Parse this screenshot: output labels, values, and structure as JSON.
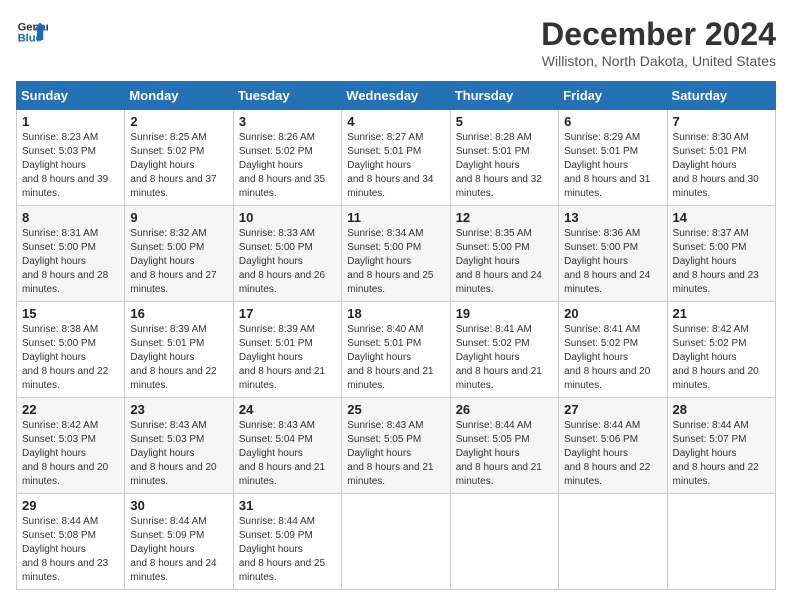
{
  "logo": {
    "line1": "General",
    "line2": "Blue"
  },
  "title": "December 2024",
  "subtitle": "Williston, North Dakota, United States",
  "days_of_week": [
    "Sunday",
    "Monday",
    "Tuesday",
    "Wednesday",
    "Thursday",
    "Friday",
    "Saturday"
  ],
  "weeks": [
    [
      {
        "day": "1",
        "sunrise": "8:23 AM",
        "sunset": "5:03 PM",
        "daylight": "8 hours and 39 minutes."
      },
      {
        "day": "2",
        "sunrise": "8:25 AM",
        "sunset": "5:02 PM",
        "daylight": "8 hours and 37 minutes."
      },
      {
        "day": "3",
        "sunrise": "8:26 AM",
        "sunset": "5:02 PM",
        "daylight": "8 hours and 35 minutes."
      },
      {
        "day": "4",
        "sunrise": "8:27 AM",
        "sunset": "5:01 PM",
        "daylight": "8 hours and 34 minutes."
      },
      {
        "day": "5",
        "sunrise": "8:28 AM",
        "sunset": "5:01 PM",
        "daylight": "8 hours and 32 minutes."
      },
      {
        "day": "6",
        "sunrise": "8:29 AM",
        "sunset": "5:01 PM",
        "daylight": "8 hours and 31 minutes."
      },
      {
        "day": "7",
        "sunrise": "8:30 AM",
        "sunset": "5:01 PM",
        "daylight": "8 hours and 30 minutes."
      }
    ],
    [
      {
        "day": "8",
        "sunrise": "8:31 AM",
        "sunset": "5:00 PM",
        "daylight": "8 hours and 28 minutes."
      },
      {
        "day": "9",
        "sunrise": "8:32 AM",
        "sunset": "5:00 PM",
        "daylight": "8 hours and 27 minutes."
      },
      {
        "day": "10",
        "sunrise": "8:33 AM",
        "sunset": "5:00 PM",
        "daylight": "8 hours and 26 minutes."
      },
      {
        "day": "11",
        "sunrise": "8:34 AM",
        "sunset": "5:00 PM",
        "daylight": "8 hours and 25 minutes."
      },
      {
        "day": "12",
        "sunrise": "8:35 AM",
        "sunset": "5:00 PM",
        "daylight": "8 hours and 24 minutes."
      },
      {
        "day": "13",
        "sunrise": "8:36 AM",
        "sunset": "5:00 PM",
        "daylight": "8 hours and 24 minutes."
      },
      {
        "day": "14",
        "sunrise": "8:37 AM",
        "sunset": "5:00 PM",
        "daylight": "8 hours and 23 minutes."
      }
    ],
    [
      {
        "day": "15",
        "sunrise": "8:38 AM",
        "sunset": "5:00 PM",
        "daylight": "8 hours and 22 minutes."
      },
      {
        "day": "16",
        "sunrise": "8:39 AM",
        "sunset": "5:01 PM",
        "daylight": "8 hours and 22 minutes."
      },
      {
        "day": "17",
        "sunrise": "8:39 AM",
        "sunset": "5:01 PM",
        "daylight": "8 hours and 21 minutes."
      },
      {
        "day": "18",
        "sunrise": "8:40 AM",
        "sunset": "5:01 PM",
        "daylight": "8 hours and 21 minutes."
      },
      {
        "day": "19",
        "sunrise": "8:41 AM",
        "sunset": "5:02 PM",
        "daylight": "8 hours and 21 minutes."
      },
      {
        "day": "20",
        "sunrise": "8:41 AM",
        "sunset": "5:02 PM",
        "daylight": "8 hours and 20 minutes."
      },
      {
        "day": "21",
        "sunrise": "8:42 AM",
        "sunset": "5:02 PM",
        "daylight": "8 hours and 20 minutes."
      }
    ],
    [
      {
        "day": "22",
        "sunrise": "8:42 AM",
        "sunset": "5:03 PM",
        "daylight": "8 hours and 20 minutes."
      },
      {
        "day": "23",
        "sunrise": "8:43 AM",
        "sunset": "5:03 PM",
        "daylight": "8 hours and 20 minutes."
      },
      {
        "day": "24",
        "sunrise": "8:43 AM",
        "sunset": "5:04 PM",
        "daylight": "8 hours and 21 minutes."
      },
      {
        "day": "25",
        "sunrise": "8:43 AM",
        "sunset": "5:05 PM",
        "daylight": "8 hours and 21 minutes."
      },
      {
        "day": "26",
        "sunrise": "8:44 AM",
        "sunset": "5:05 PM",
        "daylight": "8 hours and 21 minutes."
      },
      {
        "day": "27",
        "sunrise": "8:44 AM",
        "sunset": "5:06 PM",
        "daylight": "8 hours and 22 minutes."
      },
      {
        "day": "28",
        "sunrise": "8:44 AM",
        "sunset": "5:07 PM",
        "daylight": "8 hours and 22 minutes."
      }
    ],
    [
      {
        "day": "29",
        "sunrise": "8:44 AM",
        "sunset": "5:08 PM",
        "daylight": "8 hours and 23 minutes."
      },
      {
        "day": "30",
        "sunrise": "8:44 AM",
        "sunset": "5:09 PM",
        "daylight": "8 hours and 24 minutes."
      },
      {
        "day": "31",
        "sunrise": "8:44 AM",
        "sunset": "5:09 PM",
        "daylight": "8 hours and 25 minutes."
      },
      null,
      null,
      null,
      null
    ]
  ]
}
